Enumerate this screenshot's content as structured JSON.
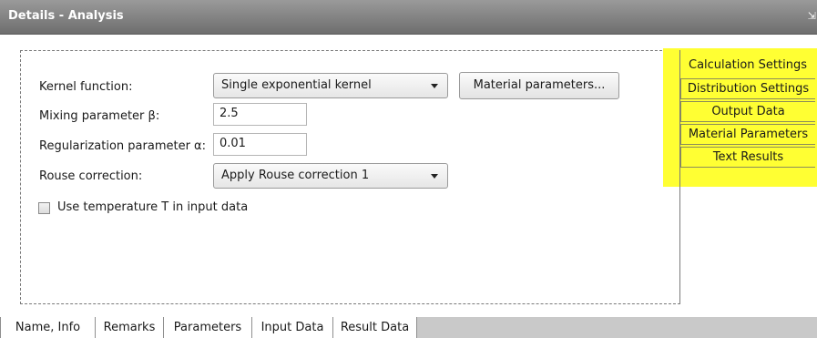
{
  "window": {
    "title": "Details - Analysis",
    "pin_glyph": "⇲"
  },
  "form": {
    "kernel_label": "Kernel function:",
    "kernel_value": "Single exponential kernel",
    "material_button": "Material parameters...",
    "mixing_label": "Mixing parameter β:",
    "mixing_value": "2.5",
    "regularization_label": "Regularization parameter α:",
    "regularization_value": "0.01",
    "rouse_label": "Rouse correction:",
    "rouse_value": "Apply Rouse correction 1",
    "temperature_checkbox_label": "Use temperature T in input data",
    "temperature_checked": false
  },
  "side_tabs": [
    {
      "label": "Calculation Settings",
      "selected": true
    },
    {
      "label": "Distribution Settings",
      "selected": false
    },
    {
      "label": "Output Data",
      "selected": false
    },
    {
      "label": "Material Parameters",
      "selected": false
    },
    {
      "label": "Text Results",
      "selected": false
    }
  ],
  "bottom_tabs": [
    {
      "label": "Name, Info",
      "selected": false
    },
    {
      "label": "Remarks",
      "selected": false
    },
    {
      "label": "Parameters",
      "selected": true
    },
    {
      "label": "Input Data",
      "selected": false
    },
    {
      "label": "Result Data",
      "selected": false
    }
  ],
  "colors": {
    "highlight": "#ffff33",
    "titlebar": "#7d7d7d"
  }
}
